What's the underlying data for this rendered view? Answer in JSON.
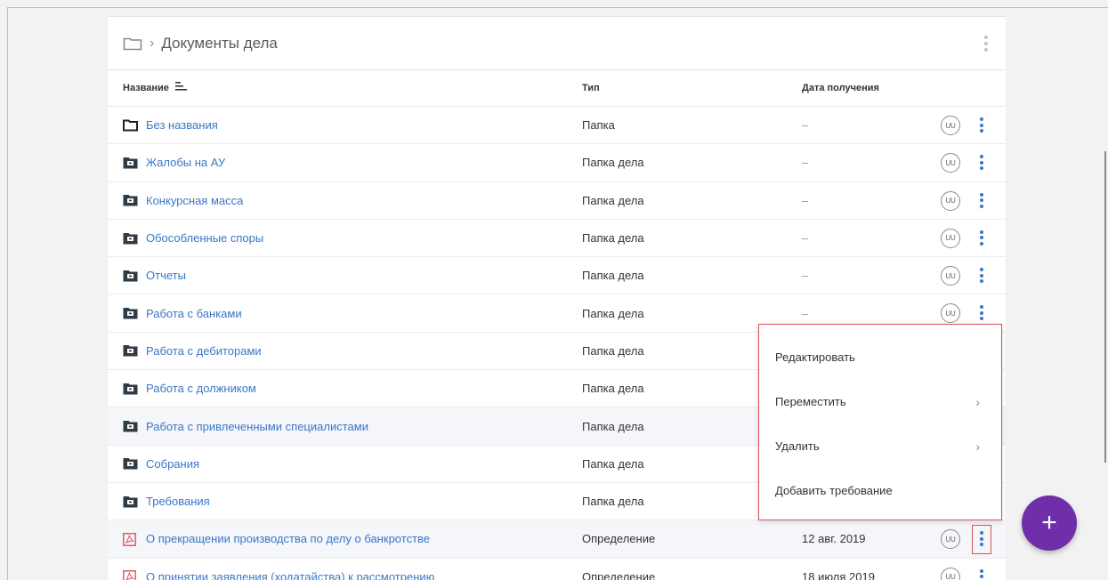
{
  "breadcrumb": {
    "separator": "›",
    "title": "Документы дела"
  },
  "columns": {
    "name": "Название",
    "type": "Тип",
    "date": "Дата получения"
  },
  "rows": [
    {
      "name": "Без названия",
      "type": "Папка",
      "date": "–",
      "icon": "folder-icon",
      "avatar": "UU"
    },
    {
      "name": "Жалобы на АУ",
      "type": "Папка дела",
      "date": "–",
      "icon": "case-folder-icon",
      "avatar": "UU"
    },
    {
      "name": "Конкурсная масса",
      "type": "Папка дела",
      "date": "–",
      "icon": "case-folder-icon",
      "avatar": "UU"
    },
    {
      "name": "Обособленные споры",
      "type": "Папка дела",
      "date": "–",
      "icon": "case-folder-icon",
      "avatar": "UU"
    },
    {
      "name": "Отчеты",
      "type": "Папка дела",
      "date": "–",
      "icon": "case-folder-icon",
      "avatar": "UU"
    },
    {
      "name": "Работа с банками",
      "type": "Папка дела",
      "date": "–",
      "icon": "case-folder-icon",
      "avatar": "UU"
    },
    {
      "name": "Работа с дебиторами",
      "type": "Папка дела",
      "date": "",
      "icon": "case-folder-icon",
      "avatar": ""
    },
    {
      "name": "Работа с должником",
      "type": "Папка дела",
      "date": "",
      "icon": "case-folder-icon",
      "avatar": ""
    },
    {
      "name": "Работа с привлеченными специалистами",
      "type": "Папка дела",
      "date": "",
      "icon": "case-folder-icon",
      "avatar": ""
    },
    {
      "name": "Собрания",
      "type": "Папка дела",
      "date": "",
      "icon": "case-folder-icon",
      "avatar": ""
    },
    {
      "name": "Требования",
      "type": "Папка дела",
      "date": "",
      "icon": "case-folder-icon",
      "avatar": ""
    },
    {
      "name": "О прекращении производства по делу о банкротстве",
      "type": "Определение",
      "date": "12 авг. 2019",
      "icon": "pdf-icon",
      "avatar": "UU"
    },
    {
      "name": "О принятии заявления (ходатайства) к рассмотрению",
      "type": "Определение",
      "date": "18 июля 2019",
      "icon": "pdf-icon",
      "avatar": "UU"
    }
  ],
  "context_menu": {
    "edit": "Редактировать",
    "move": "Переместить",
    "delete": "Удалить",
    "add_claim": "Добавить требование"
  },
  "fab_label": "+",
  "colors": {
    "link": "#3b77c7",
    "fab": "#6f2fa8",
    "highlight_border": "#d9535b",
    "pdf": "#d9535b"
  }
}
